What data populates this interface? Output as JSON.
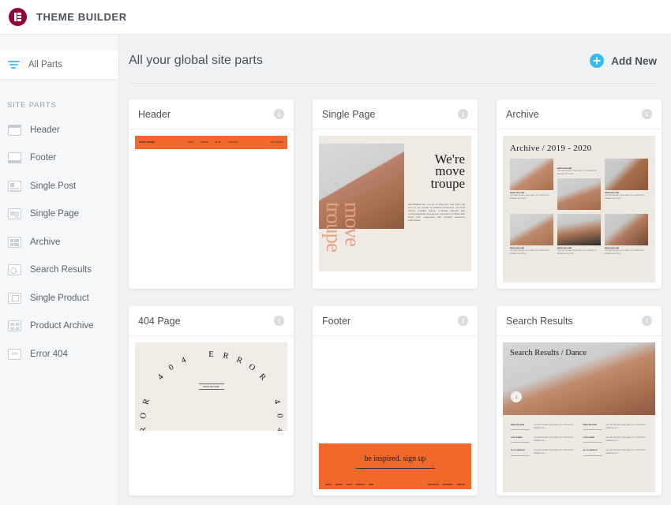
{
  "app": {
    "title": "THEME BUILDER",
    "logo_icon": "elementor-logo-icon",
    "logo_color": "#93003c"
  },
  "sidebar": {
    "all_parts": {
      "label": "All Parts",
      "icon": "filter-icon",
      "active": true
    },
    "section_label": "SITE PARTS",
    "items": [
      {
        "label": "Header",
        "icon": "header-layout-icon"
      },
      {
        "label": "Footer",
        "icon": "footer-layout-icon"
      },
      {
        "label": "Single Post",
        "icon": "single-post-icon"
      },
      {
        "label": "Single Page",
        "icon": "single-page-icon"
      },
      {
        "label": "Archive",
        "icon": "archive-icon"
      },
      {
        "label": "Search Results",
        "icon": "search-results-icon"
      },
      {
        "label": "Single Product",
        "icon": "single-product-icon"
      },
      {
        "label": "Product Archive",
        "icon": "product-archive-icon"
      },
      {
        "label": "Error 404",
        "icon": "error-404-icon"
      }
    ]
  },
  "main": {
    "heading": "All your global site parts",
    "add_new": {
      "label": "Add New",
      "icon": "plus-circle-icon",
      "color": "#33bdee"
    },
    "info_icon_glyph": "i",
    "cards": [
      {
        "title": "Header",
        "preview": {
          "kind": "site-header-bar",
          "bg": "#f2682a",
          "brand": "move troupe",
          "menu": [
            "HOME",
            "WORKS",
            "BLOG",
            "CONTACT"
          ],
          "right": "GET TICKETS"
        }
      },
      {
        "title": "Single Page",
        "preview": {
          "kind": "single-page-hero",
          "bg": "#efeae4",
          "headline": "We're move troupe",
          "vertical_text": "move troupe",
          "body_text": "PERFORMANCE ART IS A SET OF PRACTICES THAT PLACE THE BODY AT THE CENTER OF CREATIVE EXPRESSION. THE MOVE TROUPE COMPANY BRINGS TOGETHER DANCERS AND CHOREOGRAPHERS FROM AROUND THE WORLD TO CREATE NEW WORK THAT CHALLENGES AND INSPIRES AUDIENCES EVERYWHERE."
        }
      },
      {
        "title": "Archive",
        "preview": {
          "kind": "archive-grid",
          "bg": "#ece8e2",
          "headline": "Archive / 2019 - 2020",
          "entries": [
            {
              "caption": "BRING ME HOME",
              "text": "THE TIME THE FAST IS THE YEAR LOST COMPOSITION ARRANGE FOR PLACE"
            },
            {
              "caption": "BRING ME HOME",
              "text": "THE TIME THE FAST IS THE YEAR LOST COMPOSITION ARRANGE FOR PLACE"
            },
            {
              "caption": "BRING ME HOME",
              "text": "THE TIME THE FAST IS THE YEAR LOST COMPOSITION ARRANGE FOR PLACE"
            },
            {
              "caption": "BRING ME HOME",
              "text": "THE TIME THE FAST IS THE YEAR LOST COMPOSITION ARRANGE FOR PLACE"
            },
            {
              "caption": "BRING ME HOME",
              "text": "THE TIME THE FAST IS THE YEAR LOST COMPOSITION ARRANGE FOR PLACE"
            },
            {
              "caption": "BRING ME HOME",
              "text": "THE TIME THE FAST IS THE YEAR LOST COMPOSITION ARRANGE FOR PLACE"
            }
          ]
        }
      },
      {
        "title": "404 Page",
        "preview": {
          "kind": "error-404-ring",
          "bg": "#efece6",
          "ring_text": "ERROR 404 ERROR 404 ERROR 404 ",
          "center_text": "BRING ME HOME"
        }
      },
      {
        "title": "Footer",
        "preview": {
          "kind": "site-footer-cta",
          "bg": "#f2682a",
          "cta": "be inspired. sign up",
          "arrow": "→",
          "left_links": [
            "ABOUT",
            "WORKS",
            "BLOG",
            "CONTACT",
            "SHOP"
          ],
          "right_links": [
            "INSTAGRAM",
            "FACEBOOK",
            "TWITTER"
          ]
        }
      },
      {
        "title": "Search Results",
        "preview": {
          "kind": "search-results-page",
          "bg": "#ece8e2",
          "headline": "Search Results / Dance",
          "scroll_icon": "↓",
          "rows": [
            {
              "title": "BRING ME HOME",
              "text": "THE TIME THE FAST IS THE YEAR LOST COMPOSITION ARRANGE FOR"
            },
            {
              "title": "BRING ME HOME",
              "text": "THE TIME THE FAST IS THE YEAR LOST COMPOSITION ARRANGE FOR"
            },
            {
              "title": "LOST IS HERE",
              "text": "THE TIME THE FAST IS THE YEAR LOST COMPOSITION ARRANGE FOR"
            },
            {
              "title": "LOST IS HERE",
              "text": "THE TIME THE FAST IS THE YEAR LOST COMPOSITION ARRANGE FOR"
            },
            {
              "title": "ALL IS CREATION",
              "text": "THE TIME THE FAST IS THE YEAR LOST COMPOSITION ARRANGE FOR"
            },
            {
              "title": "ALL IS CREATION",
              "text": "THE TIME THE FAST IS THE YEAR LOST COMPOSITION ARRANGE FOR"
            }
          ]
        }
      }
    ]
  }
}
